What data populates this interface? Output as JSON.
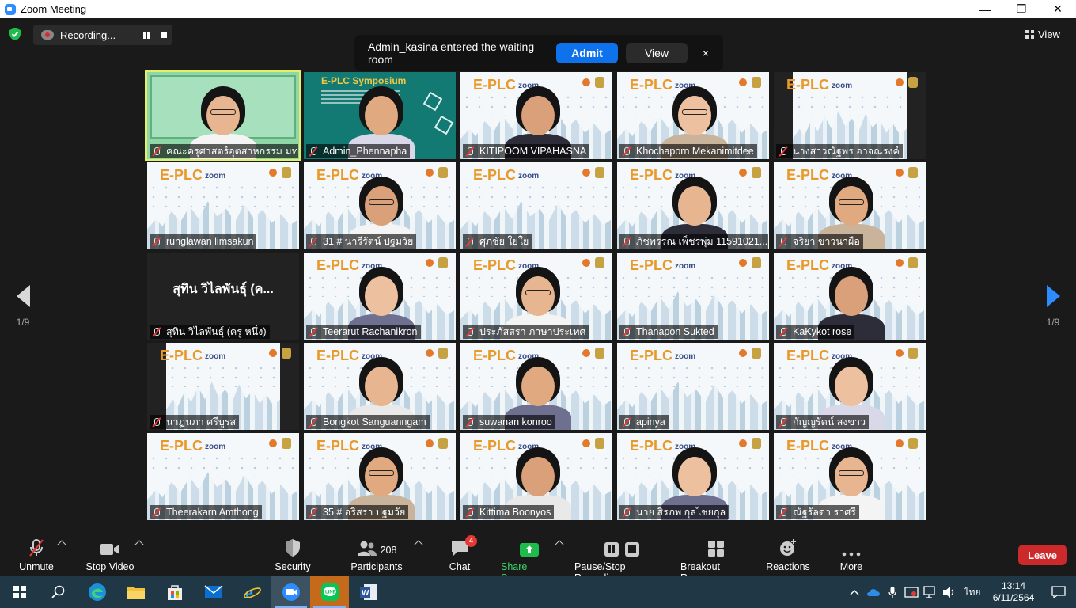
{
  "window": {
    "title": "Zoom Meeting"
  },
  "recording": {
    "label": "Recording..."
  },
  "notification": {
    "message": "Admin_kasina entered the waiting room",
    "admit_label": "Admit",
    "view_label": "View",
    "close_label": "×"
  },
  "view": {
    "label": "View"
  },
  "pagination": {
    "left": "1/9",
    "right": "1/9"
  },
  "participants": [
    {
      "name": "คณะครุศาสตร์อุตสาหกรรม มทร.ธัญ...",
      "bg": "green",
      "person": true,
      "speaker": true
    },
    {
      "name": "Admin_Phennapha",
      "bg": "symposium",
      "person": true
    },
    {
      "name": "KITIPOOM VIPAHASNA",
      "bg": "plc",
      "person": true
    },
    {
      "name": "Khochaporn Mekanimitdee",
      "bg": "plc",
      "person": true
    },
    {
      "name": "นางสาวณัฐพร อาจณรงค์",
      "bg": "plc-boxed",
      "person": false
    },
    {
      "name": "runglawan limsakun",
      "bg": "plc",
      "person": false
    },
    {
      "name": "31 # นารีรัตน์ ปฐมวัย",
      "bg": "plc",
      "person": true
    },
    {
      "name": "ศุภชัย ใยใย",
      "bg": "plc",
      "person": false
    },
    {
      "name": "ภัชพรรณ เพ็ชรพุ่ม 11591021...",
      "bg": "plc",
      "person": true
    },
    {
      "name": "จริยา ขาวนาผือ",
      "bg": "plc",
      "person": true
    },
    {
      "name": "สุทิน วิไลพันธุ์ (ครู หนึ่ง)",
      "bg": "dark",
      "person": false,
      "card": "สุทิน วิไลพันธุ์ (ค..."
    },
    {
      "name": "Teerarut Rachanikron",
      "bg": "plc",
      "person": true
    },
    {
      "name": "ประภัสสรา ภาษาประเทศ",
      "bg": "plc",
      "person": true
    },
    {
      "name": "Thanapon Sukted",
      "bg": "plc",
      "person": false
    },
    {
      "name": "KaKykot rose",
      "bg": "plc",
      "person": true
    },
    {
      "name": "นาฏนภา ศรีบูรส",
      "bg": "plc-boxed",
      "person": false
    },
    {
      "name": "Bongkot Sanguanngam",
      "bg": "plc",
      "person": true
    },
    {
      "name": "suwanan konroo",
      "bg": "plc",
      "person": true
    },
    {
      "name": "apinya",
      "bg": "plc",
      "person": false
    },
    {
      "name": "กัญญรัตน์ สงขาว",
      "bg": "plc",
      "person": true
    },
    {
      "name": "Theerakarn Amthong",
      "bg": "plc",
      "person": false
    },
    {
      "name": "35 # อริสรา ปฐมวัย",
      "bg": "plc",
      "person": true
    },
    {
      "name": "Kittima Boonyos",
      "bg": "plc",
      "person": true
    },
    {
      "name": "นาย สิรภพ กุลไชยกุล",
      "bg": "plc",
      "person": true
    },
    {
      "name": "ณัฐรัลดา ราศรี",
      "bg": "plc",
      "person": true
    }
  ],
  "plc": {
    "logo": "E-PLC",
    "zoom": "zoom"
  },
  "symposium": {
    "title": "E-PLC Symposium"
  },
  "toolbar": {
    "unmute": "Unmute",
    "stop_video": "Stop Video",
    "security": "Security",
    "participants": "Participants",
    "participants_count": "208",
    "chat": "Chat",
    "chat_badge": "4",
    "share_screen": "Share Screen",
    "pause_stop_recording": "Pause/Stop Recording",
    "breakout_rooms": "Breakout Rooms",
    "reactions": "Reactions",
    "more": "More",
    "leave": "Leave"
  },
  "taskbar": {
    "language": "ไทย",
    "time": "13:14",
    "date": "6/11/2564",
    "apps": [
      "windows-start",
      "search",
      "edge",
      "file-explorer",
      "store",
      "mail",
      "internet-explorer",
      "zoom",
      "line",
      "word"
    ]
  },
  "colors": {
    "accent_blue": "#0e72ed",
    "speaker_outline": "#e4f06a",
    "leave_red": "#cc2a2a",
    "share_green": "#3cd36a",
    "taskbar": "#203746"
  }
}
